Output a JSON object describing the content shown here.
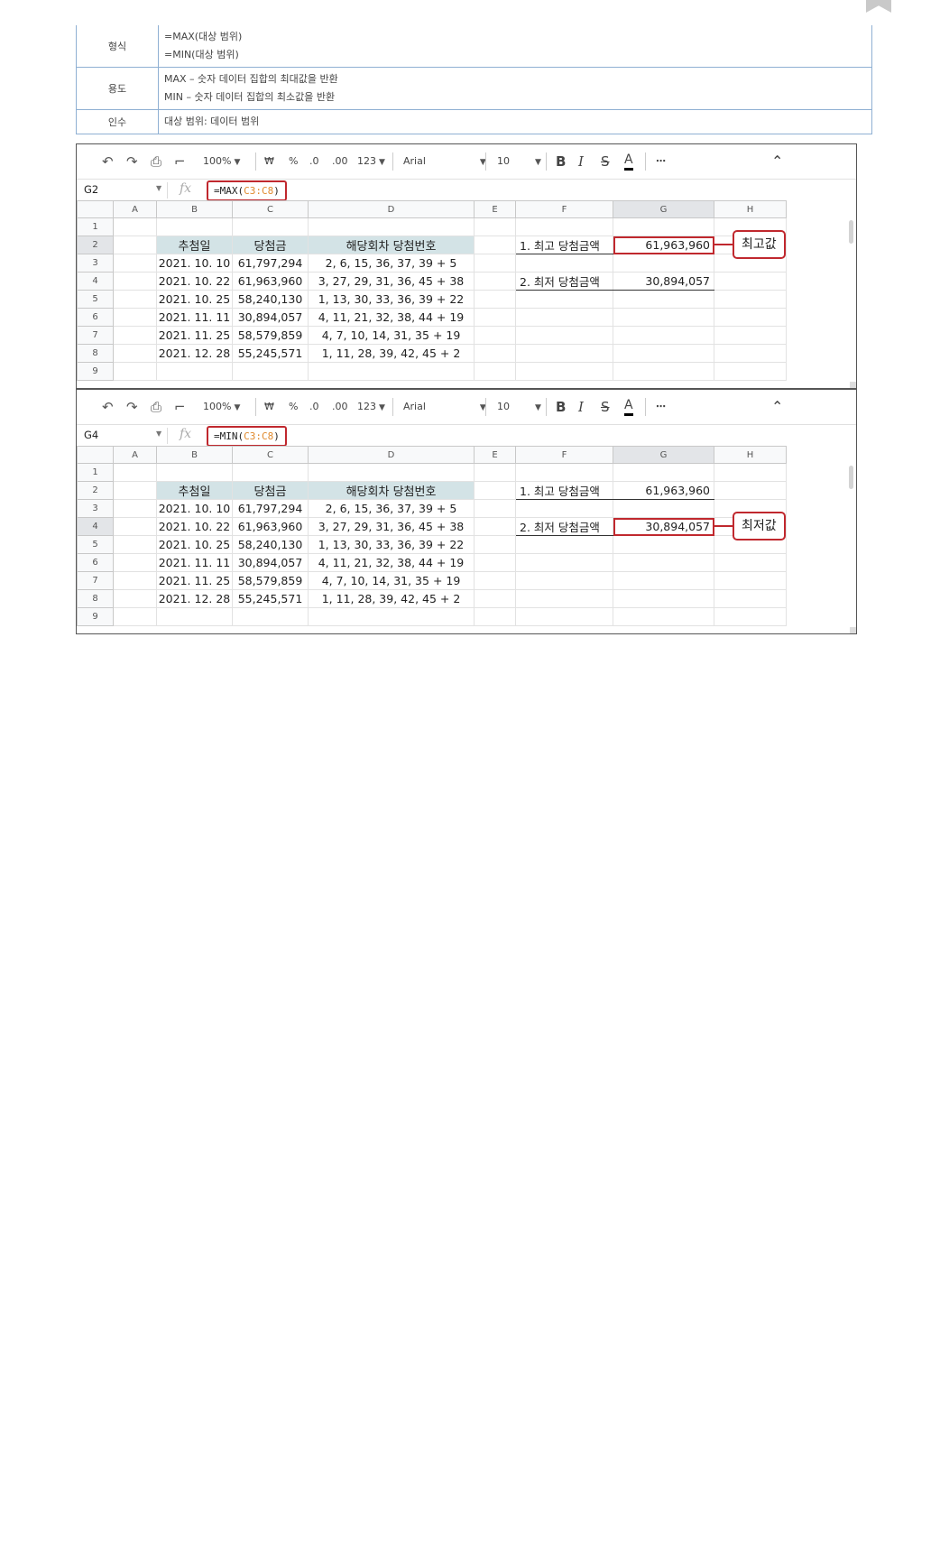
{
  "info_table": [
    {
      "key": "형식",
      "lines": [
        "=MAX(대상 범위)",
        "=MIN(대상 범위)"
      ]
    },
    {
      "key": "용도",
      "lines": [
        "MAX – 숫자 데이터 집합의 최대값을 반환",
        "MIN – 숫자 데이터 집합의 최소값을 반환"
      ]
    },
    {
      "key": "인수",
      "lines": [
        "대상 범위: 데이터 범위"
      ]
    }
  ],
  "toolbar": {
    "undo_icon": "↶",
    "redo_icon": "↷",
    "print_icon": "⎙",
    "paint_icon": "⌐",
    "zoom": "100%",
    "currency": "₩",
    "percent": "%",
    "dec_decrease": ".0",
    "dec_increase": ".00",
    "number_format": "123",
    "font": "Arial",
    "font_size": "10",
    "bold": "B",
    "italic": "I",
    "strike": "S",
    "text_color": "A",
    "more": "⋯",
    "collapse": "⌃"
  },
  "columns": [
    "A",
    "B",
    "C",
    "D",
    "E",
    "F",
    "G",
    "H"
  ],
  "rows": [
    "1",
    "2",
    "3",
    "4",
    "5",
    "6",
    "7",
    "8",
    "9"
  ],
  "table_header": {
    "date": "추첨일",
    "amount": "당첨금",
    "numbers": "해당회차 당첨번호"
  },
  "table_rows": [
    {
      "date": "2021. 10. 10",
      "amount": "61,797,294",
      "numbers": "2, 6, 15, 36, 37, 39 + 5"
    },
    {
      "date": "2021. 10. 22",
      "amount": "61,963,960",
      "numbers": "3, 27, 29, 31, 36, 45 + 38"
    },
    {
      "date": "2021. 10. 25",
      "amount": "58,240,130",
      "numbers": "1, 13, 30, 33, 36, 39 + 22"
    },
    {
      "date": "2021. 11. 11",
      "amount": "30,894,057",
      "numbers": "4, 11, 21, 32, 38, 44 + 19"
    },
    {
      "date": "2021. 11. 25",
      "amount": "58,579,859",
      "numbers": "4, 7, 10, 14, 31, 35 + 19"
    },
    {
      "date": "2021. 12. 28",
      "amount": "55,245,571",
      "numbers": "1, 11, 28, 39, 42, 45 + 2"
    }
  ],
  "summary": {
    "max_label": "1. 최고 당첨금액",
    "max_value": "61,963,960",
    "min_label": "2. 최저 당첨금액",
    "min_value": "30,894,057"
  },
  "sheets": [
    {
      "cell_ref": "G2",
      "formula_prefix": "=MAX(",
      "formula_range": "C3:C8",
      "formula_suffix": ")",
      "callout": "최고값"
    },
    {
      "cell_ref": "G4",
      "formula_prefix": "=MIN(",
      "formula_range": "C3:C8",
      "formula_suffix": ")",
      "callout": "최저값"
    }
  ],
  "colors": {
    "highlight": "#c0282e",
    "header_fill": "#d3e3e6",
    "range_text": "#e08a2e"
  }
}
